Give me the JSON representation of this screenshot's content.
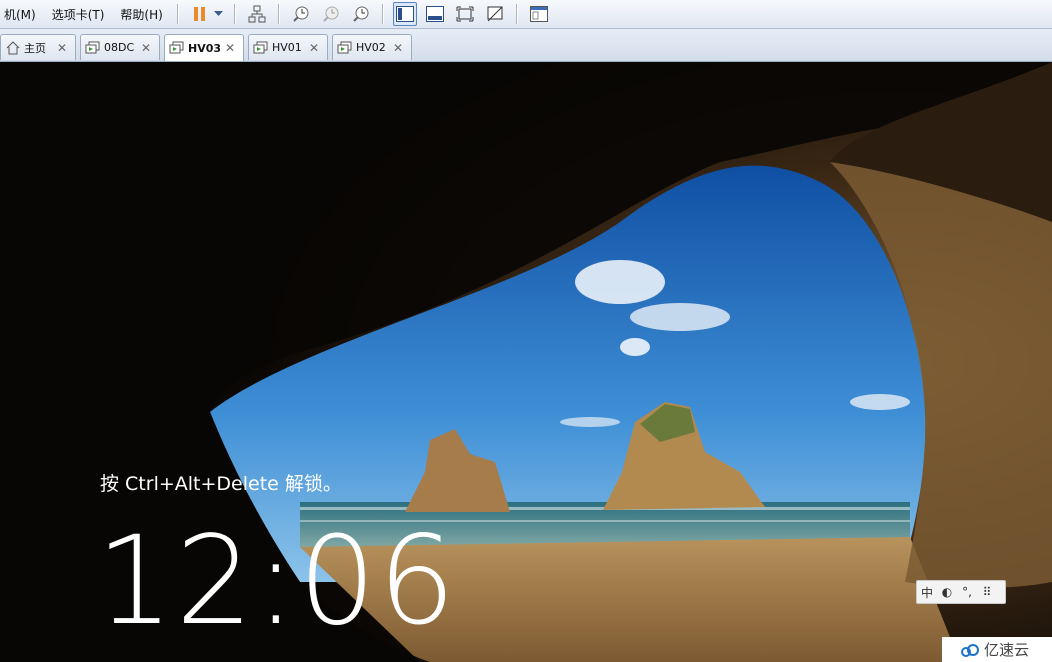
{
  "menu": {
    "items": [
      "机(M)",
      "选项卡(T)",
      "帮助(H)"
    ]
  },
  "toolbar": {
    "icons": [
      "pause-icon",
      "dropdown-icon",
      "network-icon",
      "snapshot-take-icon",
      "snapshot-revert-icon",
      "snapshot-manager-icon",
      "view-sidebar-icon",
      "view-console-icon",
      "fullscreen-icon",
      "unity-icon",
      "library-icon"
    ]
  },
  "tabs": [
    {
      "label": "主页",
      "icon": "home-icon",
      "active": false
    },
    {
      "label": "08DC",
      "icon": "vm-icon",
      "active": false
    },
    {
      "label": "HV03",
      "icon": "vm-icon",
      "active": true
    },
    {
      "label": "HV01",
      "icon": "vm-icon",
      "active": false
    },
    {
      "label": "HV02",
      "icon": "vm-icon",
      "active": false
    }
  ],
  "lockscreen": {
    "message": "按 Ctrl+Alt+Delete 解锁。",
    "time": "12:06"
  },
  "ime": {
    "mode": "中"
  },
  "watermark": {
    "text": "亿速云"
  }
}
